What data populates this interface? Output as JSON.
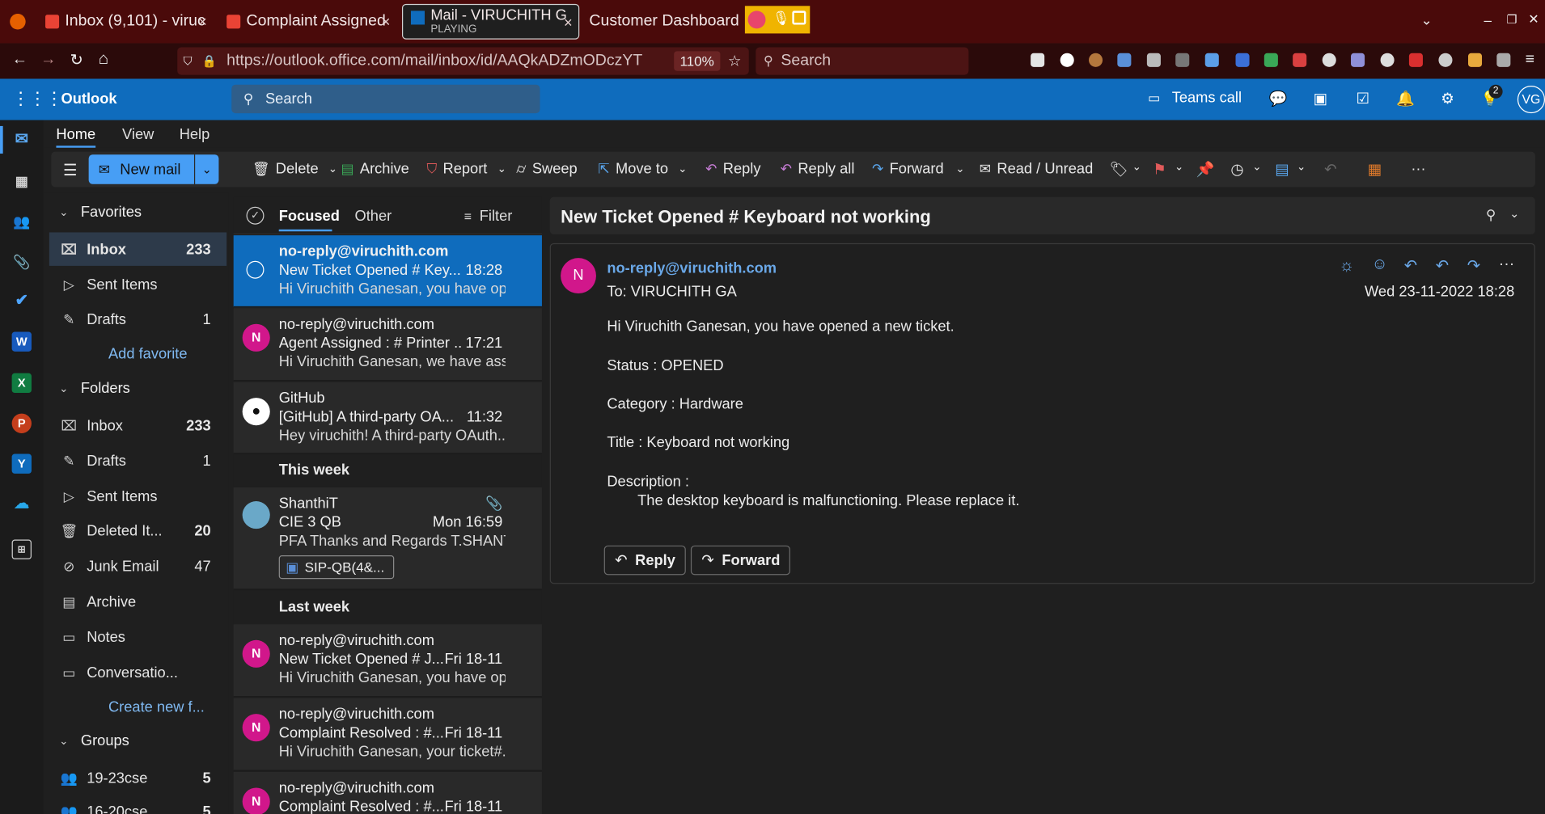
{
  "browser": {
    "tabs": [
      {
        "title": "Inbox (9,101) - viruc",
        "close": "×"
      },
      {
        "title": "Complaint Assigned",
        "close": "×"
      },
      {
        "title": "Mail - VIRUCHITH G",
        "subtitle": "PLAYING",
        "close": "×"
      },
      {
        "title": "Customer Dashboard"
      }
    ],
    "tab_list_icon": "chevron-down",
    "window_controls": {
      "minimize": "–",
      "restore": "❐",
      "close": "✕"
    },
    "url": "https://outlook.office.com/mail/inbox/id/AAQkADZmODczYT",
    "url_host": "outlook.office.com",
    "zoom": "110%",
    "search_placeholder": "Search"
  },
  "outlook": {
    "app_name": "Outlook",
    "search_placeholder": "Search",
    "teams_call": "Teams call",
    "tips_badge": "2",
    "avatar_initials": "VG"
  },
  "ribbon_tabs": [
    "Home",
    "View",
    "Help"
  ],
  "ribbon": {
    "new_mail": "New mail",
    "delete": "Delete",
    "archive": "Archive",
    "report": "Report",
    "sweep": "Sweep",
    "move_to": "Move to",
    "reply": "Reply",
    "reply_all": "Reply all",
    "forward": "Forward",
    "read_unread": "Read / Unread",
    "more": "···"
  },
  "folders": {
    "favorites_label": "Favorites",
    "favorites": [
      {
        "label": "Inbox",
        "count": "233"
      },
      {
        "label": "Sent Items",
        "count": ""
      },
      {
        "label": "Drafts",
        "count": "1"
      }
    ],
    "add_favorite": "Add favorite",
    "folders_label": "Folders",
    "items": [
      {
        "label": "Inbox",
        "count": "233"
      },
      {
        "label": "Drafts",
        "count": "1"
      },
      {
        "label": "Sent Items",
        "count": ""
      },
      {
        "label": "Deleted It...",
        "count": "20"
      },
      {
        "label": "Junk Email",
        "count": "47"
      },
      {
        "label": "Archive",
        "count": ""
      },
      {
        "label": "Notes",
        "count": ""
      },
      {
        "label": "Conversatio...",
        "count": ""
      }
    ],
    "create_new": "Create new f...",
    "groups_label": "Groups",
    "groups": [
      {
        "label": "19-23cse",
        "count": "5"
      },
      {
        "label": "16-20cse",
        "count": "5"
      }
    ]
  },
  "message_list": {
    "focused": "Focused",
    "other": "Other",
    "filter": "Filter",
    "messages": [
      {
        "sender": "no-reply@viruchith.com",
        "subject": "New Ticket Opened # Key...",
        "time": "18:28",
        "preview": "Hi Viruchith Ganesan, you have op..."
      },
      {
        "sender": "no-reply@viruchith.com",
        "subject": "Agent Assigned : # Printer ...",
        "time": "17:21",
        "preview": "Hi Viruchith Ganesan, we have ass...",
        "avatar": "N"
      },
      {
        "sender": "GitHub",
        "subject": "[GitHub] A third-party OA...",
        "time": "11:32",
        "preview": "Hey viruchith! A third-party OAuth..."
      }
    ],
    "this_week": "This week",
    "week_message": {
      "sender": "ShanthiT",
      "subject": "CIE 3 QB",
      "time": "Mon 16:59",
      "preview": "PFA Thanks and Regards T.SHANT...",
      "attachment": "SIP-QB(4&..."
    },
    "last_week": "Last week",
    "last_week_messages": [
      {
        "sender": "no-reply@viruchith.com",
        "subject": "New Ticket Opened # J...",
        "time": "Fri 18-11",
        "preview": "Hi Viruchith Ganesan, you have op...",
        "avatar": "N"
      },
      {
        "sender": "no-reply@viruchith.com",
        "subject": "Complaint Resolved : #...",
        "time": "Fri 18-11",
        "preview": "Hi Viruchith Ganesan, your ticket#...",
        "avatar": "N"
      },
      {
        "sender": "no-reply@viruchith.com",
        "subject": "Complaint Resolved : #...",
        "time": "Fri 18-11",
        "preview": "",
        "avatar": "N"
      }
    ]
  },
  "reading": {
    "subject": "New Ticket Opened # Keyboard not working",
    "from": "no-reply@viruchith.com",
    "avatar": "N",
    "to": "To: VIRUCHITH GA",
    "date": "Wed 23-11-2022 18:28",
    "lines": [
      "Hi Viruchith Ganesan, you have opened a new ticket.",
      "Status : OPENED",
      "Category : Hardware",
      "Title : Keyboard not working",
      "Description :",
      "The desktop keyboard is malfunctioning. Please replace it."
    ],
    "reply_btn": "Reply",
    "forward_btn": "Forward"
  },
  "colors": {
    "accent": "#0f6cbd",
    "new_mail": "#479ef5",
    "avatar_pink": "#d1178b"
  }
}
